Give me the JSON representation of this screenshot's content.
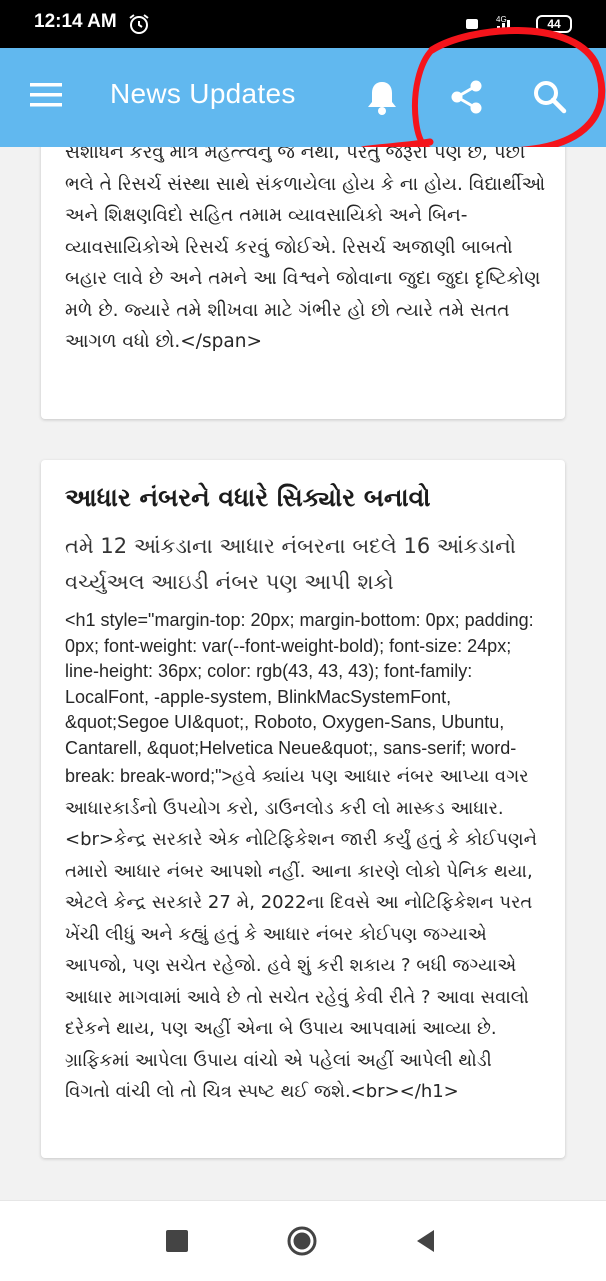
{
  "status_bar": {
    "time": "12:14 AM",
    "battery": "44",
    "network": "4G"
  },
  "app_bar": {
    "title": "News Updates",
    "icons": [
      "menu-icon",
      "bell-icon",
      "share-icon",
      "search-icon"
    ],
    "color": "#61b8ef"
  },
  "articles": [
    {
      "partial_top_line": "… … … … … … … … … … … …",
      "body": "સંશોધન કરવું માત્ર મહત્ત્વનું જ નથી, પરંતુ જરૂરી પણ છે, પછી ભલે તે રિસર્ચ સંસ્થા સાથે સંકળાયેલા હોય કે ના હોય. વિદ્યાર્થીઓ અને શિક્ષણવિદો સહિત તમામ વ્યાવસાયિકો અને બિન-વ્યાવસાયિકોએ રિસર્ચ કરવું જોઈએ. રિસર્ચ અજાણી બાબતો બહાર લાવે છે અને તમને આ વિશ્વને જોવાના જુદા જુદા દૃષ્ટિકોણ મળે છે. જ્યારે તમે શીખવા માટે ગંભીર હો છો ત્યારે તમે સતત આગળ વધો છો.</span>"
    },
    {
      "title": "આધાર નંબરને વધારે સિક્યોર બનાવો",
      "subtitle": "તમે 12 આંકડાના આધાર નંબરના બદલે 16 આંકડાનો વર્ચ્યુઅલ આઇડી નંબર પણ આપી શકો",
      "html_prefix": "<h1 style=\"margin-top: 20px; margin-bottom: 0px; padding: 0px; font-weight: var(--font-weight-bold); font-size: 24px; line-height: 36px; color: rgb(43, 43, 43); font-family: LocalFont, -apple-system, BlinkMacSystemFont, &quot;Segoe UI&quot;, Roboto, Oxygen-Sans, Ubuntu, Cantarell, &quot;Helvetica Neue&quot;, sans-serif; word-break: break-word;\">",
      "body": "હવે ક્યાંય પણ આધાર નંબર આપ્યા વગર આધારકાર્ડનો ઉપયોગ કરો, ડાઉનલોડ કરી લો માસ્કડ આધાર.<br>કેન્દ્ર સરકારે એક નોટિફિકેશન જારી કર્યું હતું કે કોઈપણને તમારો આધાર નંબર આપશો નહીં. આના કારણે લોકો પેનિક થયા, એટલે કેન્દ્ર સરકારે 27 મે, 2022ના દિવસે આ નોટિફિકેશન પરત ખેંચી લીધું અને કહ્યું હતું કે આધાર નંબર કોઈપણ જગ્યાએ આપજો, પણ સચેત રહેજો. હવે શું કરી શકાય ? બધી જગ્યાએ આધાર માગવામાં આવે છે તો સચેત રહેવું કેવી રીતે ? આવા સવાલો દરેકને થાય, પણ અહીં એના બે ઉપાય આપવામાં આવ્યા છે. ગ્રાફિકમાં આપેલા ઉપાય વાંચો એ પહેલાં અહીં આપેલી થોડી વિગતો વાંચી લો તો ચિત્ર સ્પષ્ટ થઈ જશે.<br></h1>"
    }
  ],
  "nav_bar": {
    "icons": [
      "recent-apps-icon",
      "home-icon",
      "back-icon"
    ]
  }
}
